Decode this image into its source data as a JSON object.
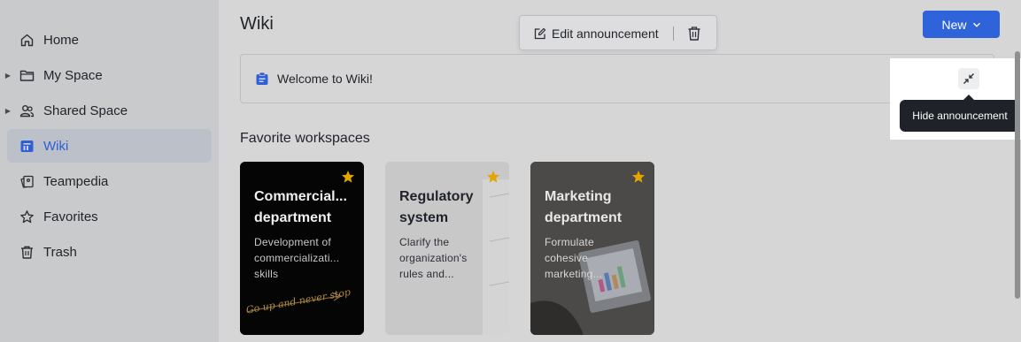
{
  "sidebar": {
    "items": [
      {
        "label": "Home",
        "icon": "home-icon",
        "expandable": false,
        "active": false
      },
      {
        "label": "My Space",
        "icon": "folder-icon",
        "expandable": true,
        "active": false
      },
      {
        "label": "Shared Space",
        "icon": "people-icon",
        "expandable": true,
        "active": false
      },
      {
        "label": "Wiki",
        "icon": "wiki-icon",
        "expandable": false,
        "active": true
      },
      {
        "label": "Teampedia",
        "icon": "teampedia-icon",
        "expandable": false,
        "active": false
      },
      {
        "label": "Favorites",
        "icon": "star-outline-icon",
        "expandable": false,
        "active": false
      },
      {
        "label": "Trash",
        "icon": "trash-icon",
        "expandable": false,
        "active": false
      }
    ]
  },
  "header": {
    "title": "Wiki",
    "new_label": "New"
  },
  "announcement_toolbar": {
    "edit_label": "Edit announcement"
  },
  "announcement": {
    "text": "Welcome to Wiki!",
    "tooltip": "Hide announcement"
  },
  "favorites": {
    "title": "Favorite workspaces",
    "cards": [
      {
        "title": "Commercial... department",
        "title_line1": "Commercial...",
        "title_line2": "department",
        "desc_line1": "Development of",
        "desc_line2": "commercializati...",
        "desc_line3": "skills",
        "artwork_text": "Go up and never stop"
      },
      {
        "title": "Regulatory system",
        "title_line1": "Regulatory",
        "title_line2": "system",
        "desc_line1": "Clarify the",
        "desc_line2": "organization's",
        "desc_line3": "rules and..."
      },
      {
        "title": "Marketing department",
        "title_line1": "Marketing",
        "title_line2": "department",
        "desc_line1": "Formulate",
        "desc_line2": "cohesive",
        "desc_line3": "marketing..."
      }
    ]
  },
  "colors": {
    "accent": "#2f63d9",
    "star": "#e3a600",
    "tooltip_bg": "#1f2329"
  }
}
